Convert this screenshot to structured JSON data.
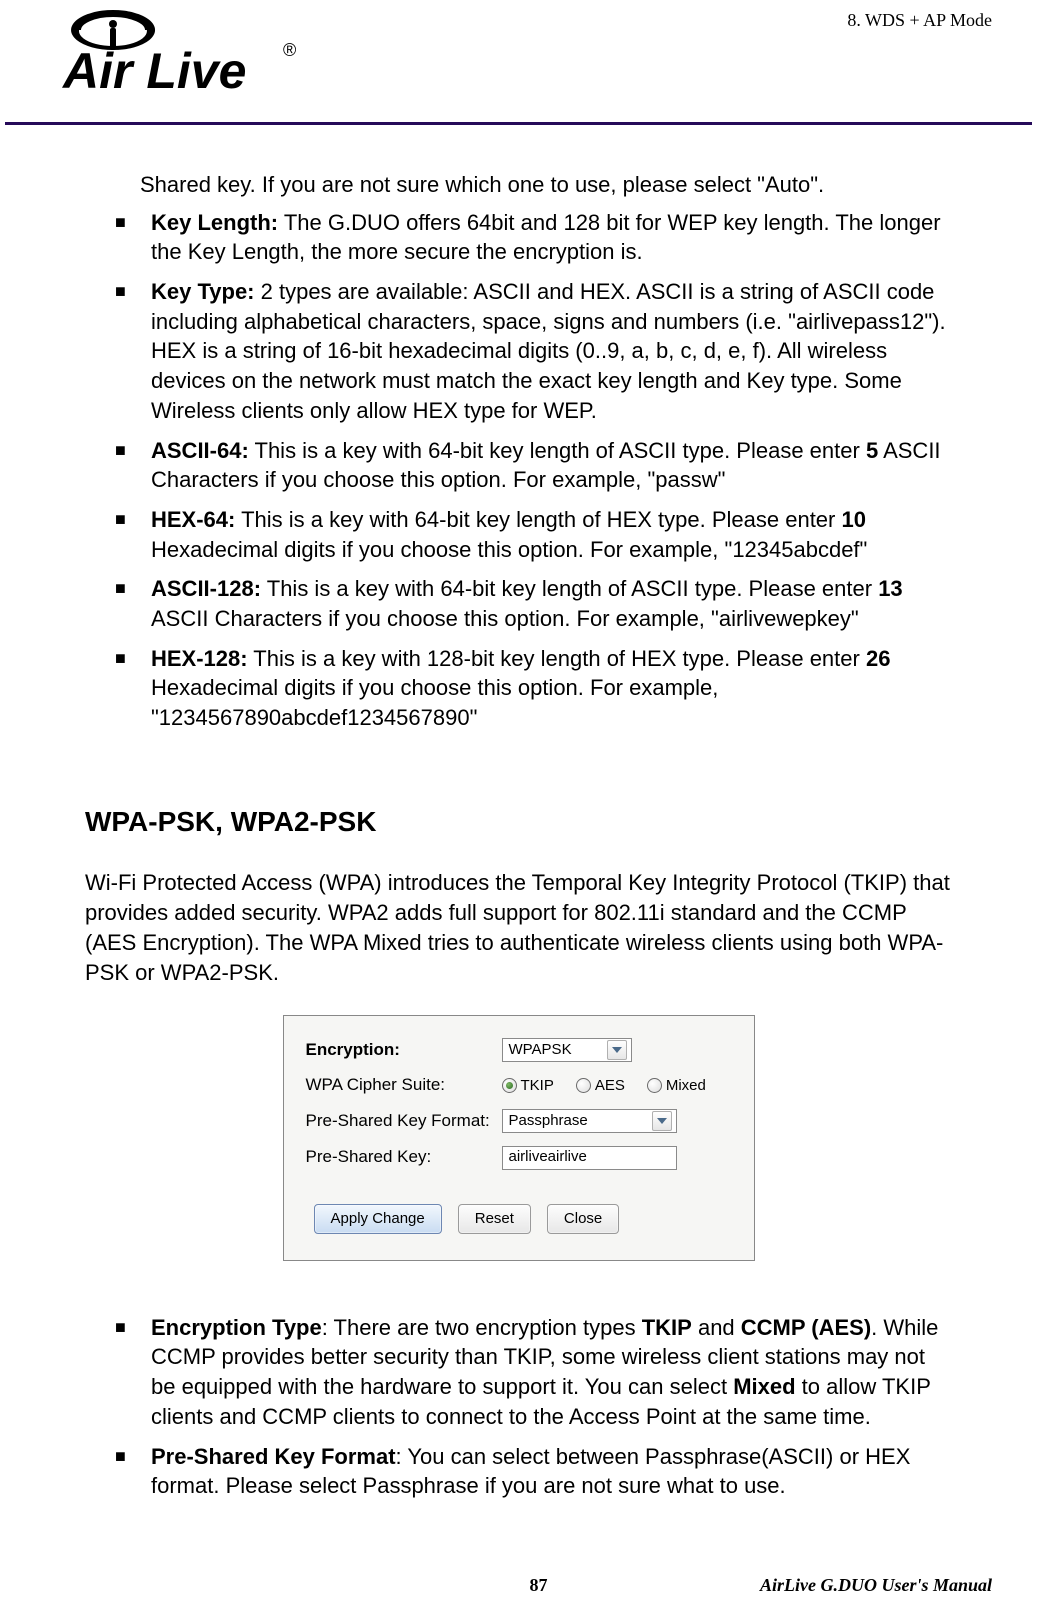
{
  "header": {
    "chapter": "8.  WDS  +  AP  Mode",
    "logo_text_main": "Air Live",
    "logo_text_reg": "®"
  },
  "intro": "Shared key.    If you are not sure which one to use, please select \"Auto\".",
  "wep_items": [
    {
      "bold": "Key Length:",
      "rest": "   The G.DUO offers 64bit and 128 bit for WEP key length.    The longer the Key Length, the more secure the encryption is."
    },
    {
      "bold": "Key Type:",
      "rest": "   2 types are available: ASCII and HEX.    ASCII is a string of ASCII code including alphabetical characters, space, signs and numbers (i.e. \"airlivepass12\").    HEX is a string of 16-bit hexadecimal digits (0..9, a, b, c, d, e, f). All wireless devices on the network must match the exact key length and Key type. Some Wireless clients only allow HEX type for WEP."
    },
    {
      "bold": "ASCII-64:",
      "rest": " This is a key with 64-bit key length of ASCII type.    Please enter ",
      "bold2": "5",
      "rest2": " ASCII Characters if you choose this option. For example, \"passw\""
    },
    {
      "bold": "HEX-64:",
      "rest": " This is a key with 64-bit key length of HEX type.    Please enter ",
      "bold2": "10",
      "rest2": " Hexadecimal digits if you choose this option. For example, \"12345abcdef\""
    },
    {
      "bold": "ASCII-128:",
      "rest": " This is a key with 64-bit key length of ASCII type.    Please enter ",
      "bold2": "13",
      "rest2": " ASCII Characters if you choose this option. For example, \"airlivewepkey\""
    },
    {
      "bold": "HEX-128:",
      "rest": " This is a key with 128-bit key length of HEX type.    Please enter ",
      "bold2": "26",
      "rest2": " Hexadecimal digits if you choose this option. For example, \"1234567890abcdef1234567890\""
    }
  ],
  "section": {
    "heading": "WPA-PSK, WPA2-PSK",
    "body": "Wi-Fi Protected Access (WPA) introduces the Temporal Key Integrity Protocol (TKIP) that provides added security.    WPA2 adds full support for 802.11i standard and the CCMP (AES Encryption).    The WPA Mixed tries to authenticate wireless clients using both WPA-PSK or WPA2-PSK."
  },
  "ui": {
    "encryption_label": "Encryption:",
    "encryption_value": "WPAPSK",
    "cipher_label": "WPA Cipher Suite:",
    "radios": {
      "tkip": "TKIP",
      "aes": "AES",
      "mixed": "Mixed"
    },
    "format_label": "Pre-Shared Key Format:",
    "format_value": "Passphrase",
    "key_label": "Pre-Shared Key:",
    "key_value": "airliveairlive",
    "buttons": {
      "apply": "Apply Change",
      "reset": "Reset",
      "close": "Close"
    }
  },
  "enc_items": [
    {
      "bold": "Encryption Type",
      "colon": ":   There are two encryption types ",
      "bold2": "TKIP",
      "mid": " and ",
      "bold3": "CCMP (AES)",
      "rest": ". While CCMP provides better security than TKIP, some wireless client stations may not be equipped with the hardware to support it. You can select ",
      "bold4": "Mixed",
      "rest2": " to allow TKIP clients and CCMP clients to connect to the Access Point at the same time."
    },
    {
      "bold": "Pre-Shared Key Format",
      "colon": ":    You can select between Passphrase(ASCII) or HEX format.    Please select Passphrase if you are not sure what to use."
    }
  ],
  "footer": {
    "page": "87",
    "manual": "AirLive  G.DUO  User's  Manual"
  }
}
